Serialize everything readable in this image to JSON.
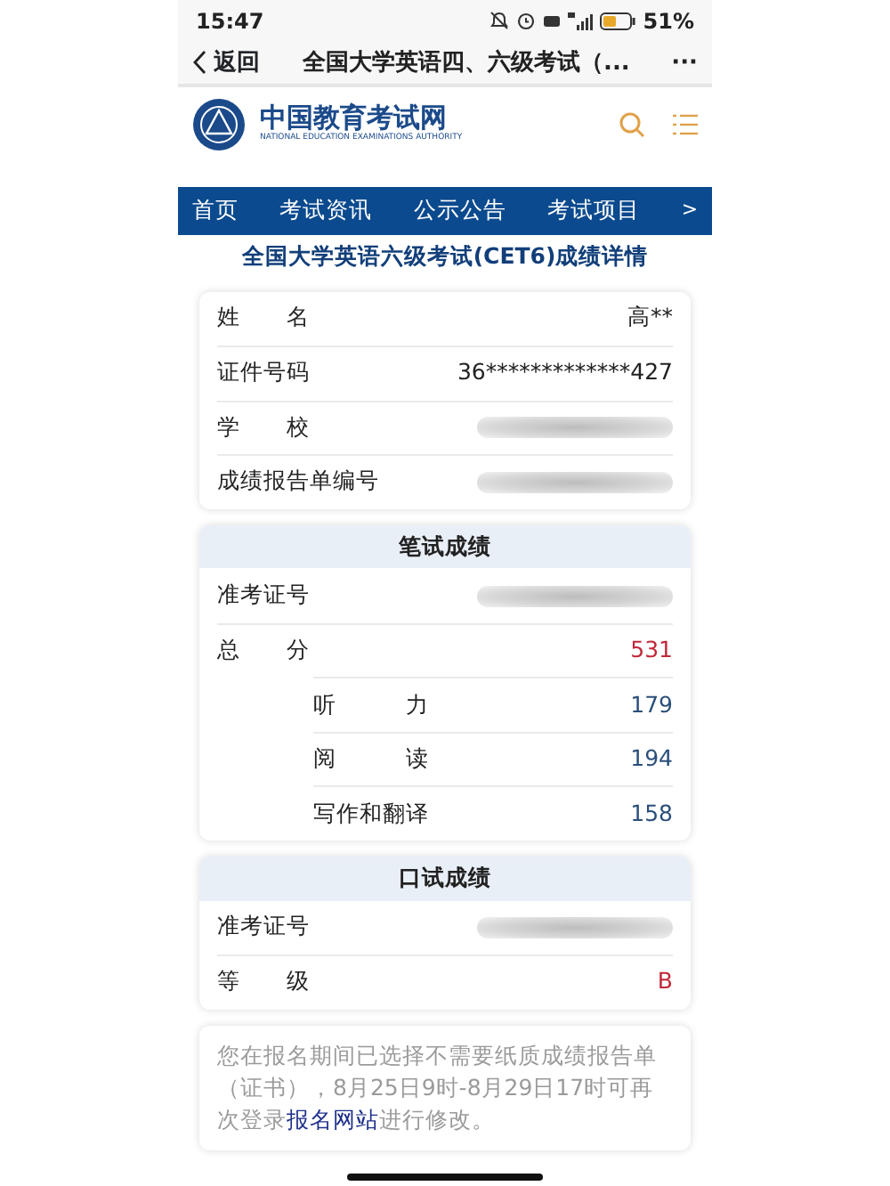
{
  "status_bar": {
    "time": "15:47",
    "battery_text": "51%"
  },
  "nav_bar": {
    "back": "返回",
    "title": "全国大学英语四、六级考试（...",
    "more": "···"
  },
  "site_header": {
    "name": "中国教育考试网",
    "subtitle": "NATIONAL EDUCATION EXAMINATIONS AUTHORITY"
  },
  "menu": {
    "items": [
      "首页",
      "考试资讯",
      "公示公告",
      "考试项目"
    ],
    "more": ">"
  },
  "heading": "全国大学英语六级考试(CET6)成绩详情",
  "info_card": {
    "rows": [
      {
        "label": "姓　　名",
        "kind": "text",
        "value": "高**"
      },
      {
        "label": "证件号码",
        "kind": "text",
        "value": "36*************427"
      },
      {
        "label": "学　　校",
        "kind": "redacted"
      },
      {
        "label": "成绩报告单编号",
        "kind": "redacted"
      }
    ]
  },
  "written_card": {
    "title": "笔试成绩",
    "rows": [
      {
        "label": "准考证号",
        "kind": "redacted"
      },
      {
        "label": "总　　分",
        "kind": "result",
        "value": "531",
        "children": [
          {
            "label": "听　　　力",
            "kind": "score",
            "value": "179"
          },
          {
            "label": "阅　　　读",
            "kind": "score",
            "value": "194"
          },
          {
            "label": "写作和翻译",
            "kind": "score",
            "value": "158"
          }
        ]
      }
    ]
  },
  "oral_card": {
    "title": "口试成绩",
    "rows": [
      {
        "label": "准考证号",
        "kind": "redacted"
      },
      {
        "label": "等　　级",
        "kind": "result",
        "value": "B"
      }
    ]
  },
  "note": {
    "before": "您在报名期间已选择不需要纸质成绩报告单（证书），8月25日9时-8月29日17时可再次登录",
    "link": "报名网站",
    "after": "进行修改。"
  }
}
